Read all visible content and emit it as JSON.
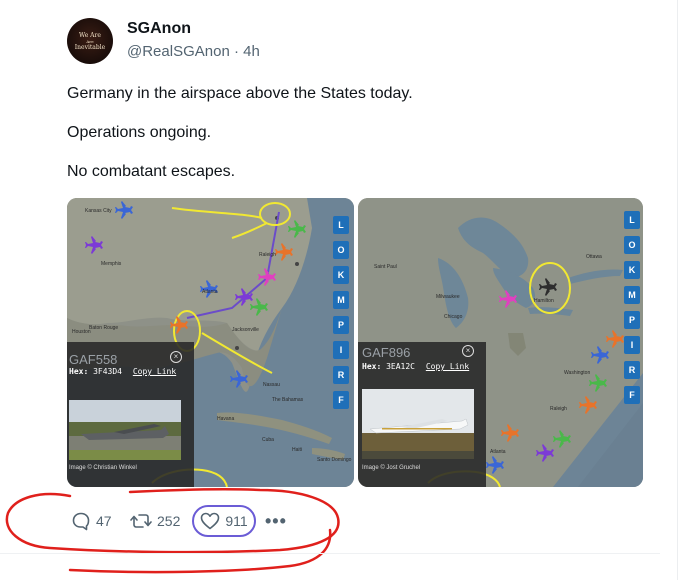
{
  "author": {
    "display_name": "SGAnon",
    "handle": "@RealSGAnon",
    "separator": "·",
    "time": "4h",
    "avatar_text": [
      "We Are",
      "Inevitable"
    ]
  },
  "post": {
    "lines": [
      "Germany in the airspace above the States today.",
      "Operations ongoing.",
      "No combatant escapes."
    ]
  },
  "media": [
    {
      "callsign": "GAF558",
      "hex_label": "Hex:",
      "hex_value": "3F43D4",
      "copy_link": "Copy Link",
      "photo_credit": "Image © Christian Winkel",
      "buttons": [
        "L",
        "O",
        "K",
        "M",
        "P",
        "I",
        "R",
        "F"
      ],
      "map_labels": [
        "Kansas City",
        "Memphis",
        "Raleigh",
        "Atlanta",
        "Houston",
        "Baton Rouge",
        "Jacksonville",
        "Nassau",
        "Havana",
        "The Bahamas",
        "Cuba",
        "Haiti",
        "Santo Domingo"
      ]
    },
    {
      "callsign": "GAF896",
      "hex_label": "Hex:",
      "hex_value": "3EA12C",
      "copy_link": "Copy Link",
      "photo_credit": "Image © Jost Gruchel",
      "buttons": [
        "L",
        "O",
        "K",
        "M",
        "P",
        "I",
        "R",
        "F"
      ],
      "map_labels": [
        "Saint Paul",
        "Ottawa",
        "Milwaukee",
        "Hamilton",
        "Chicago",
        "Washington",
        "Raleigh",
        "Atlanta"
      ]
    }
  ],
  "actions": {
    "replies": "47",
    "reposts": "252",
    "likes": "911",
    "more": "•••"
  },
  "colors": {
    "like_outline": "#6b5cd6",
    "scribble": "#e0201c",
    "highlight": "#f1e832",
    "map_button": "#1f6fb8"
  },
  "icons": [
    "reply-icon",
    "repost-icon",
    "heart-icon",
    "more-icon",
    "plane-icon",
    "close-icon"
  ]
}
